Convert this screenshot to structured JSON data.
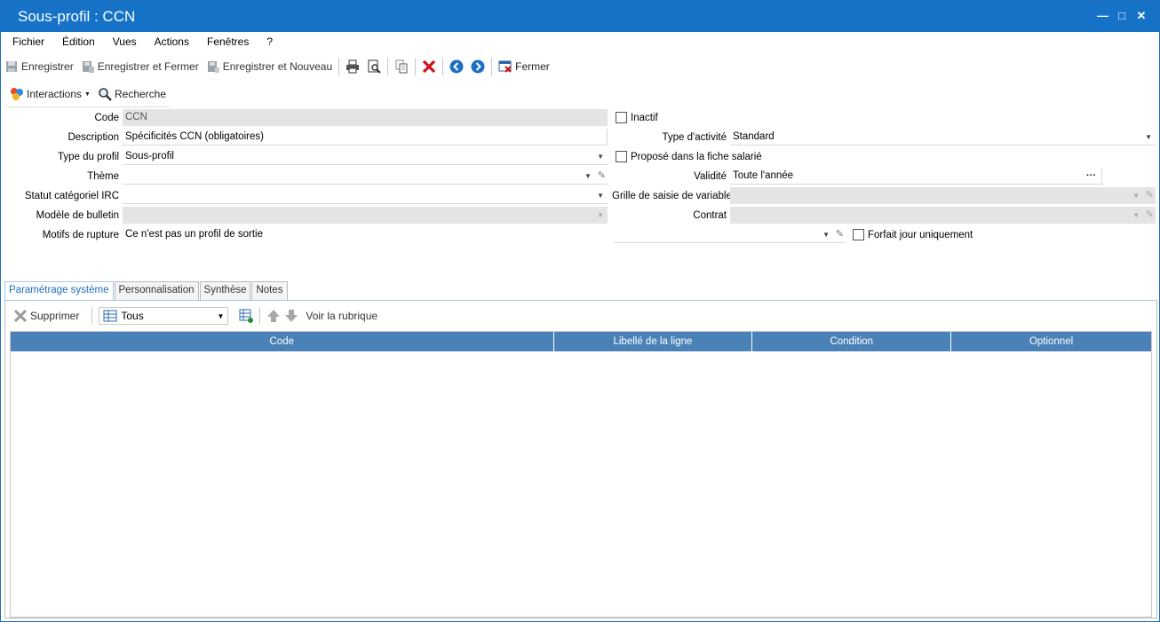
{
  "window": {
    "title": "Sous-profil : CCN"
  },
  "menu": [
    "Fichier",
    "Édition",
    "Vues",
    "Actions",
    "Fenêtres",
    "?"
  ],
  "toolbar": {
    "save": "Enregistrer",
    "save_close": "Enregistrer et Fermer",
    "save_new": "Enregistrer et Nouveau",
    "close": "Fermer"
  },
  "toolbar2": {
    "interactions": "Interactions",
    "search": "Recherche"
  },
  "form": {
    "code": {
      "label": "Code",
      "value": "CCN"
    },
    "description": {
      "label": "Description",
      "value": "Spécificités CCN (obligatoires)"
    },
    "type_profil": {
      "label": "Type du profil",
      "value": "Sous-profil"
    },
    "theme": {
      "label": "Thème",
      "value": ""
    },
    "statut": {
      "label": "Statut catégoriel IRC",
      "value": ""
    },
    "modele": {
      "label": "Modèle de bulletin",
      "value": ""
    },
    "motifs": {
      "label": "Motifs de rupture",
      "value": "Ce n'est pas un profil de sortie"
    },
    "inactif": {
      "label": "Inactif",
      "checked": false
    },
    "type_activite": {
      "label": "Type d'activité",
      "value": "Standard"
    },
    "propose": {
      "label": "Proposé dans la fiche salarié",
      "checked": false
    },
    "validite": {
      "label": "Validité",
      "value": "Toute l'année"
    },
    "grille": {
      "label": "Grille de saisie de variables",
      "value": ""
    },
    "contrat": {
      "label": "Contrat",
      "value": ""
    },
    "forfait": {
      "label": "Forfait jour uniquement",
      "checked": false
    },
    "ellipsis": "···"
  },
  "tabs": [
    "Paramétrage système",
    "Personnalisation",
    "Synthèse",
    "Notes"
  ],
  "grid_toolbar": {
    "delete": "Supprimer",
    "filter": "Tous",
    "view": "Voir la rubrique"
  },
  "grid": {
    "columns": [
      "Code",
      "Libellé de la ligne",
      "Condition",
      "Optionnel"
    ]
  },
  "colors": {
    "titlebar": "#1572c6",
    "grid_header": "#4a82b8",
    "accent": "#1e6fbf"
  }
}
